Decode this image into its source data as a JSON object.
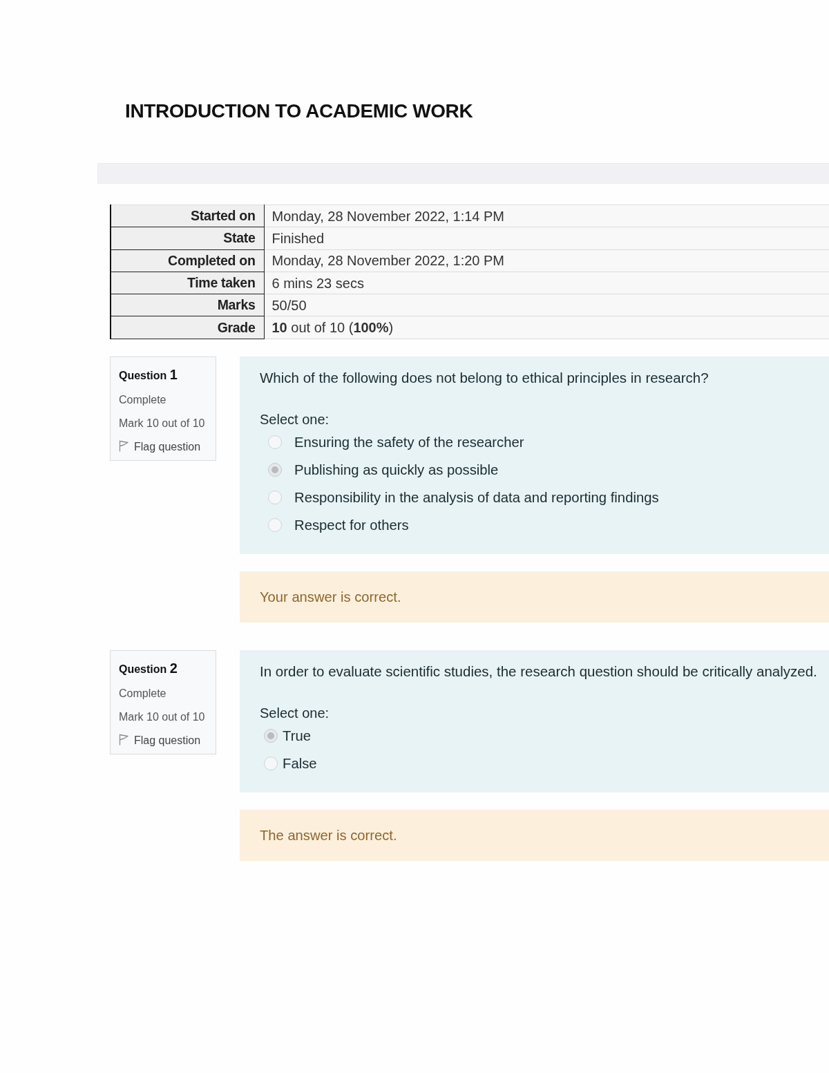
{
  "title": "INTRODUCTION TO ACADEMIC WORK",
  "summary": [
    {
      "label": "Started on",
      "value": "Monday, 28 November 2022, 1:14 PM"
    },
    {
      "label": "State",
      "value": "Finished"
    },
    {
      "label": "Completed on",
      "value": "Monday, 28 November 2022, 1:20 PM"
    },
    {
      "label": "Time taken",
      "value": "6 mins 23 secs"
    },
    {
      "label": "Marks",
      "value": "50/50"
    },
    {
      "label": "Grade",
      "value": "**10** out of 10 (**100%**)"
    }
  ],
  "questions": [
    {
      "kind": "multichoice",
      "label": "Question",
      "number": "1",
      "status": "Complete",
      "mark": "Mark 10 out of 10",
      "flag": "Flag question",
      "text": "Which of the following does not belong to ethical principles in research?",
      "prompt": "Select one:",
      "options": [
        {
          "label": "Ensuring the safety of the researcher",
          "selected": false
        },
        {
          "label": "Publishing as quickly as possible",
          "selected": true
        },
        {
          "label": "Responsibility in the analysis of data and reporting findings",
          "selected": false
        },
        {
          "label": "Respect for others",
          "selected": false
        }
      ],
      "feedback": "Your answer is correct."
    },
    {
      "kind": "truefalse",
      "label": "Question",
      "number": "2",
      "status": "Complete",
      "mark": "Mark 10 out of 10",
      "flag": "Flag question",
      "text": "In order to evaluate scientific studies, the research question should be critically analyzed.",
      "prompt": "Select one:",
      "options": [
        {
          "label": "True",
          "selected": true
        },
        {
          "label": "False",
          "selected": false
        }
      ],
      "feedback": "The answer is correct."
    }
  ]
}
